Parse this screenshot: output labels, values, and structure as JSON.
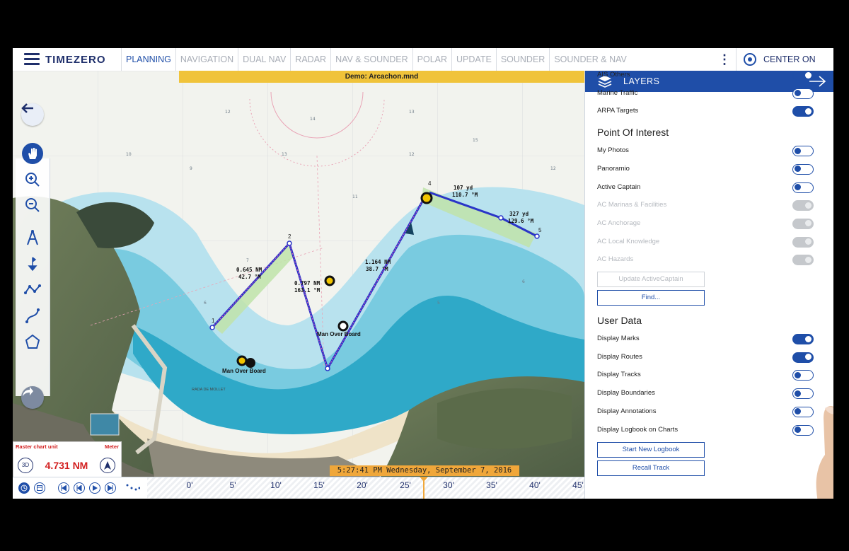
{
  "topbar": {
    "brand": "TIMEZERO",
    "tabs": [
      "PLANNING",
      "NAVIGATION",
      "DUAL NAV",
      "RADAR",
      "NAV & SOUNDER",
      "POLAR",
      "UPDATE",
      "SOUNDER",
      "SOUNDER & NAV"
    ],
    "active_tab": "PLANNING",
    "more_label": "⋮",
    "center_on_label": "CENTER ON"
  },
  "map": {
    "demo_banner": "Demo: Arcachon.mnd",
    "route1": {
      "wp_labels": [
        "1",
        "2"
      ],
      "leg1_label": [
        "0.645 NM",
        "42.7 °M"
      ],
      "leg2_label": [
        "0.797 NM",
        "163.1 °M"
      ],
      "leg3_label": [
        "1.164 NM",
        "38.7 °M"
      ]
    },
    "route2": {
      "wp_labels": [
        "4",
        "5"
      ],
      "leg1_label": [
        "107 yd",
        "110.7 °M"
      ],
      "leg2_label": [
        "327 yd",
        "129.6 °M"
      ]
    },
    "mob_label_1": "Man Over Board",
    "mob_label_2": "Man Over Board",
    "place_label": "RADA DE MOLLET",
    "more_tools": "•••"
  },
  "info_box": {
    "unit_label": "Raster chart unit",
    "unit_value": "Meter",
    "btn_3d": "3D",
    "distance": "4.731 NM"
  },
  "timeline": {
    "timestamp": "5:27:41 PM Wednesday, September 7, 2016",
    "ticks": [
      "0'",
      "5'",
      "10'",
      "15'",
      "20'",
      "25'",
      "30'",
      "35'",
      "40'",
      "45'"
    ]
  },
  "layers": {
    "title": "LAYERS",
    "ais_rows": [
      {
        "label": "AIS Others",
        "state": "on"
      },
      {
        "label": "Marine Traffic",
        "state": "off"
      },
      {
        "label": "ARPA Targets",
        "state": "on"
      }
    ],
    "poi_title": "Point Of Interest",
    "poi_rows": [
      {
        "label": "My Photos",
        "state": "off"
      },
      {
        "label": "Panoramio",
        "state": "off"
      },
      {
        "label": "Active Captain",
        "state": "off"
      },
      {
        "label": "AC Marinas & Facilities",
        "state": "disabled"
      },
      {
        "label": "AC Anchorage",
        "state": "disabled"
      },
      {
        "label": "AC Local Knowledge",
        "state": "disabled"
      },
      {
        "label": "AC Hazards",
        "state": "disabled"
      }
    ],
    "update_ac_button": "Update ActiveCaptain",
    "find_button": "Find...",
    "user_title": "User Data",
    "user_rows": [
      {
        "label": "Display Marks",
        "state": "on"
      },
      {
        "label": "Display Routes",
        "state": "on"
      },
      {
        "label": "Display Tracks",
        "state": "off"
      },
      {
        "label": "Display Boundaries",
        "state": "off"
      },
      {
        "label": "Display Annotations",
        "state": "off"
      },
      {
        "label": "Display Logbook on Charts",
        "state": "off"
      }
    ],
    "start_logbook_button": "Start New Logbook",
    "recall_track_button": "Recall Track"
  },
  "colors": {
    "brand_blue": "#1f4ea8",
    "route_blue": "#2a35c8",
    "banner_yellow": "#f0c33a",
    "time_orange": "#f0a73a",
    "alert_red": "#d21f1f"
  }
}
